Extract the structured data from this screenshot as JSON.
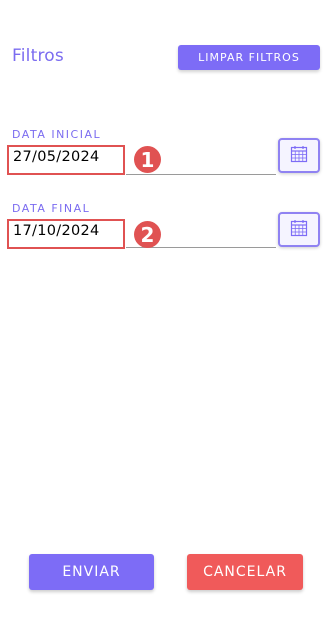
{
  "header": {
    "title": "Filtros",
    "clear_label": "LIMPAR FILTROS"
  },
  "fields": [
    {
      "label": "DATA INICIAL",
      "value": "27/05/2024",
      "badge": "1",
      "calendar_icon": "calendar-icon"
    },
    {
      "label": "DATA FINAL",
      "value": "17/10/2024",
      "badge": "2",
      "calendar_icon": "calendar-icon"
    }
  ],
  "footer": {
    "send_label": "ENVIAR",
    "cancel_label": "CANCELAR"
  },
  "colors": {
    "accent": "#7d6cf6",
    "danger": "#f05a5a",
    "annotation": "#e05252"
  }
}
